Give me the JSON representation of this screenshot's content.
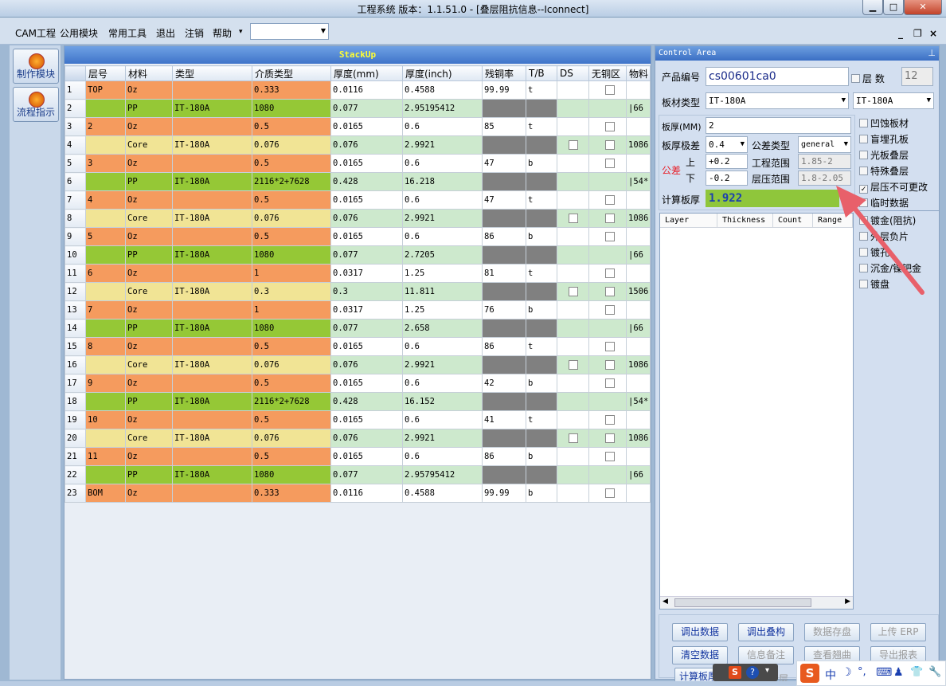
{
  "window": {
    "title": "工程系统   版本：1.1.51.0 - [叠层阻抗信息--Iconnect]",
    "min": "▁",
    "max": "□",
    "close": "✕"
  },
  "menu": [
    "CAM工程",
    "公用模块",
    "常用工具",
    "退出",
    "注销",
    "帮助"
  ],
  "menu_arrow": "▾",
  "mdi": {
    "min": "_",
    "restore": "❐",
    "close": "×"
  },
  "left_buttons": [
    "制作模块",
    "流程指示"
  ],
  "stackup": {
    "title": "StackUp",
    "headers": [
      "层号",
      "材料",
      "类型",
      "介质类型",
      "厚度(mm)",
      "厚度(inch)",
      "残铜率",
      "T/B",
      "DS",
      "无铜区",
      "物料"
    ],
    "rows": [
      [
        "1",
        "TOP",
        "Oz",
        "",
        "0.333",
        "0.0116",
        "0.4588",
        "99.99",
        "t",
        "",
        "☐",
        ""
      ],
      [
        "2",
        "",
        "PP",
        "IT-180A",
        "1080",
        "0.077",
        "2.95195412",
        "",
        "",
        "",
        "",
        "|66"
      ],
      [
        "3",
        "2",
        "Oz",
        "",
        "0.5",
        "0.0165",
        "0.6",
        "85",
        "t",
        "",
        "☐",
        ""
      ],
      [
        "4",
        "",
        "Core",
        "IT-180A",
        "0.076",
        "0.076",
        "2.9921",
        "",
        "",
        "☐",
        "☐",
        "1086"
      ],
      [
        "5",
        "3",
        "Oz",
        "",
        "0.5",
        "0.0165",
        "0.6",
        "47",
        "b",
        "",
        "☐",
        ""
      ],
      [
        "6",
        "",
        "PP",
        "IT-180A",
        "2116*2+7628",
        "0.428",
        "16.218",
        "",
        "",
        "",
        "",
        "|54*"
      ],
      [
        "7",
        "4",
        "Oz",
        "",
        "0.5",
        "0.0165",
        "0.6",
        "47",
        "t",
        "",
        "☐",
        ""
      ],
      [
        "8",
        "",
        "Core",
        "IT-180A",
        "0.076",
        "0.076",
        "2.9921",
        "",
        "",
        "☐",
        "☐",
        "1086"
      ],
      [
        "9",
        "5",
        "Oz",
        "",
        "0.5",
        "0.0165",
        "0.6",
        "86",
        "b",
        "",
        "☐",
        ""
      ],
      [
        "10",
        "",
        "PP",
        "IT-180A",
        "1080",
        "0.077",
        "2.7205",
        "",
        "",
        "",
        "",
        "|66"
      ],
      [
        "11",
        "6",
        "Oz",
        "",
        "1",
        "0.0317",
        "1.25",
        "81",
        "t",
        "",
        "☐",
        ""
      ],
      [
        "12",
        "",
        "Core",
        "IT-180A",
        "0.3",
        "0.3",
        "11.811",
        "",
        "",
        "☐",
        "☐",
        "1506"
      ],
      [
        "13",
        "7",
        "Oz",
        "",
        "1",
        "0.0317",
        "1.25",
        "76",
        "b",
        "",
        "☐",
        ""
      ],
      [
        "14",
        "",
        "PP",
        "IT-180A",
        "1080",
        "0.077",
        "2.658",
        "",
        "",
        "",
        "",
        "|66"
      ],
      [
        "15",
        "8",
        "Oz",
        "",
        "0.5",
        "0.0165",
        "0.6",
        "86",
        "t",
        "",
        "☐",
        ""
      ],
      [
        "16",
        "",
        "Core",
        "IT-180A",
        "0.076",
        "0.076",
        "2.9921",
        "",
        "",
        "☐",
        "☐",
        "1086"
      ],
      [
        "17",
        "9",
        "Oz",
        "",
        "0.5",
        "0.0165",
        "0.6",
        "42",
        "b",
        "",
        "☐",
        ""
      ],
      [
        "18",
        "",
        "PP",
        "IT-180A",
        "2116*2+7628",
        "0.428",
        "16.152",
        "",
        "",
        "",
        "",
        "|54*"
      ],
      [
        "19",
        "10",
        "Oz",
        "",
        "0.5",
        "0.0165",
        "0.6",
        "41",
        "t",
        "",
        "☐",
        ""
      ],
      [
        "20",
        "",
        "Core",
        "IT-180A",
        "0.076",
        "0.076",
        "2.9921",
        "",
        "",
        "☐",
        "☐",
        "1086"
      ],
      [
        "21",
        "11",
        "Oz",
        "",
        "0.5",
        "0.0165",
        "0.6",
        "86",
        "b",
        "",
        "☐",
        ""
      ],
      [
        "22",
        "",
        "PP",
        "IT-180A",
        "1080",
        "0.077",
        "2.95795412",
        "",
        "",
        "",
        "",
        "|66"
      ],
      [
        "23",
        "BOM",
        "Oz",
        "",
        "0.333",
        "0.0116",
        "0.4588",
        "99.99",
        "b",
        "",
        "☐",
        ""
      ]
    ]
  },
  "control": {
    "title": "Control Area",
    "pin": "⊥",
    "product_label": "产品编号",
    "product_value": "cs00601ca0",
    "layers_label": "层  数",
    "layers_value": "12",
    "board_type_label": "板材类型",
    "board_type_value": "IT-180A",
    "board_type_value2": "IT-180A",
    "thickness_label": "板厚(MM)",
    "thickness_value": "2",
    "thickness_tol_label": "板厚极差",
    "thickness_tol_value": "0.4",
    "tol_type_label": "公差类型",
    "tol_type_value": "general",
    "tol_label": "公差",
    "up_label": "上",
    "down_label": "下",
    "up_value": "+0.2",
    "down_value": "-0.2",
    "eng_range_label": "工程范围",
    "eng_range_value": "1.85-2",
    "press_range_label": "层压范围",
    "press_range_value": "1.8-2.05",
    "calc_label": "计算板厚",
    "calc_value": "1.922",
    "list_headers": [
      "Layer",
      "Thickness",
      "Count",
      "Range"
    ],
    "checkboxes": [
      {
        "label": "凹蚀板材",
        "checked": false
      },
      {
        "label": "盲埋孔板",
        "checked": false
      },
      {
        "label": "光板叠层",
        "checked": false
      },
      {
        "label": "特殊叠层",
        "checked": false
      },
      {
        "label": "层压不可更改",
        "checked": true
      },
      {
        "label": "临时数据",
        "checked": false
      }
    ],
    "checkboxes2": [
      {
        "label": "镀金(阻抗)",
        "checked": false
      },
      {
        "label": "外层负片",
        "checked": false
      },
      {
        "label": "镀孔",
        "checked": false
      },
      {
        "label": "沉金/镍钯金",
        "checked": false
      },
      {
        "label": "镀盘",
        "checked": false
      }
    ],
    "buttons": [
      [
        "调出数据",
        "调出叠构",
        "数据存盘",
        "上传 ERP"
      ],
      [
        "清空数据",
        "信息备注",
        "查看翘曲",
        "导出报表"
      ]
    ],
    "bottom_button": "计算板厚",
    "bottom_partial": "层"
  },
  "ime": {
    "s": "S",
    "zh": "中",
    "moon": "☽",
    "dot": "°,",
    "kb": "⌨",
    "person": "♟",
    "shirt": "👕",
    "wrench": "🔧"
  },
  "accent": {
    "arrow": "#e8606a",
    "calc_bg": "#8fc63b",
    "calc_text": "#1a3fb0"
  }
}
